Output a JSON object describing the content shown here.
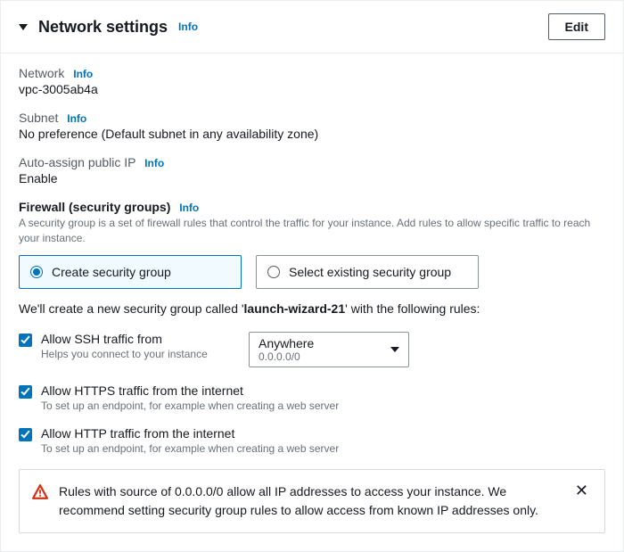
{
  "header": {
    "title": "Network settings",
    "info": "Info",
    "edit": "Edit"
  },
  "fields": {
    "network": {
      "label": "Network",
      "info": "Info",
      "value": "vpc-3005ab4a"
    },
    "subnet": {
      "label": "Subnet",
      "info": "Info",
      "value": "No preference (Default subnet in any availability zone)"
    },
    "publicIp": {
      "label": "Auto-assign public IP",
      "info": "Info",
      "value": "Enable"
    }
  },
  "firewall": {
    "title": "Firewall (security groups)",
    "info": "Info",
    "desc": "A security group is a set of firewall rules that control the traffic for your instance. Add rules to allow specific traffic to reach your instance.",
    "options": {
      "create": "Create security group",
      "select": "Select existing security group"
    },
    "sentence_prefix": "We'll create a new security group called '",
    "sg_name": "launch-wizard-21",
    "sentence_suffix": "' with the following rules:"
  },
  "rules": {
    "ssh": {
      "label": "Allow SSH traffic from",
      "hint": "Helps you connect to your instance",
      "source_label": "Anywhere",
      "source_cidr": "0.0.0.0/0"
    },
    "https": {
      "label": "Allow HTTPS traffic from the internet",
      "hint": "To set up an endpoint, for example when creating a web server"
    },
    "http": {
      "label": "Allow HTTP traffic from the internet",
      "hint": "To set up an endpoint, for example when creating a web server"
    }
  },
  "alert": {
    "text": "Rules with source of 0.0.0.0/0 allow all IP addresses to access your instance. We recommend setting security group rules to allow access from known IP addresses only."
  }
}
